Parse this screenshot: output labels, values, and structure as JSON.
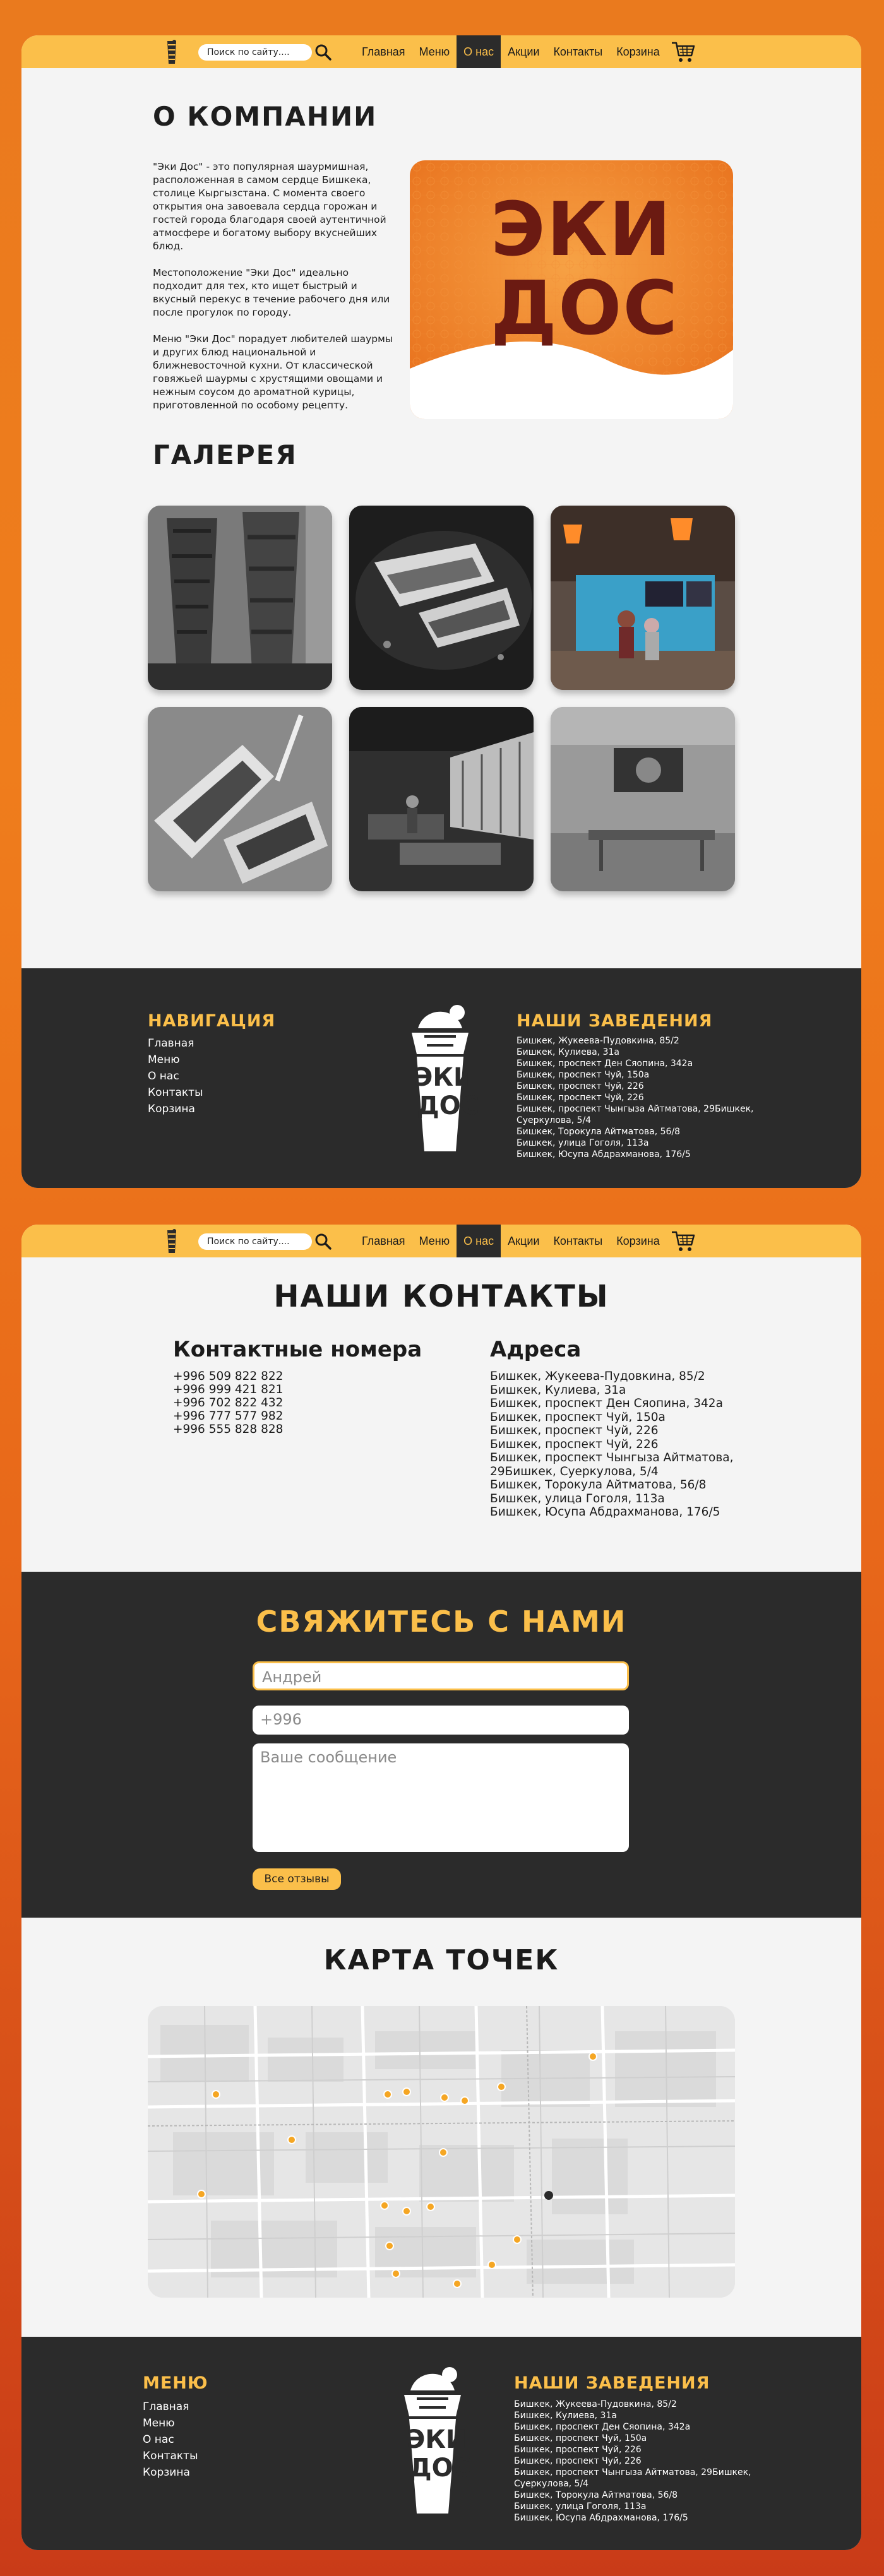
{
  "colors": {
    "accent": "#fbbf4a",
    "dark": "#2b2b2b",
    "page": "#f4f4f4",
    "brand_orange": "#ee7a20",
    "brand_red": "#6b1a12"
  },
  "header": {
    "search_placeholder": "Поиск по сайту....",
    "nav": [
      "Главная",
      "Меню",
      "О нас",
      "Акции",
      "Контакты",
      "Корзина"
    ],
    "active": "О нас"
  },
  "about": {
    "title": "О КОМПАНИИ",
    "paragraphs": [
      "\"Эки Дос\" - это популярная шаурмишная, расположенная в самом сердце Бишкека, столице Кыргызстана. С момента своего открытия она завоевала сердца горожан и гостей города благодаря своей аутентичной атмосфере и богатому выбору вкуснейших блюд.",
      "Местоположение \"Эки Дос\" идеально подходит для тех, кто ищет быстрый и вкусный перекус в течение рабочего дня или после прогулок по городу.",
      "Меню \"Эки Дос\" порадует любителей шаурмы и других блюд национальной и ближневосточной кухни. От классической говяжьей шаурмы с хрустящими овощами и нежным соусом до ароматной курицы, приготовленной по особому рецепту."
    ],
    "brand_line1": "ЭКИ",
    "brand_line2": "ДОС"
  },
  "gallery": {
    "title": "ГАЛЕРЕЯ"
  },
  "footer1": {
    "nav_title": "НАВИГАЦИЯ",
    "links": [
      "Главная",
      "Меню",
      "О нас",
      "Контакты",
      "Корзина"
    ],
    "logo_line1": "ЭКИ",
    "logo_line2": "ДОС",
    "places_title": "НАШИ ЗАВЕДЕНИЯ",
    "addresses": "Бишкек, Жукеева-Пудовкина, 85/2\nБишкек, Кулиева, 31а\nБишкек, проспект Ден Сяопина, 342а\nБишкек, проспект Чуй, 150а\nБишкек, проспект Чуй, 226\nБишкек, проспект Чуй, 226\nБишкек, проспект Чынгыза Айтматова, 29Бишкек, Суеркулова, 5/4\nБишкек, Торокула Айтматова, 56/8\nБишкек, улица Гоголя, 113а\nБишкек, Юсупа Абдрахманова, 176/5"
  },
  "contacts": {
    "title": "НАШИ КОНТАКТЫ",
    "phones_title": "Контактные номера",
    "phones": "+996 509 822 822\n+996 999 421 821\n+996 702 822 432\n+996 777 577 982\n+996 555 828 828",
    "addresses_title": "Адреса",
    "addresses": "Бишкек, Жукеева-Пудовкина, 85/2\nБишкек, Кулиева, 31а\nБишкек, проспект Ден Сяопина, 342а\nБишкек, проспект Чуй, 150а\nБишкек, проспект Чуй, 226\nБишкек, проспект Чуй, 226\nБишкек, проспект Чынгыза Айтматова, 29Бишкек, Суеркулова, 5/4\nБишкек, Торокула Айтматова, 56/8\nБишкек, улица Гоголя, 113а\nБишкек, Юсупа Абдрахманова, 176/5"
  },
  "form": {
    "title": "СВЯЖИТЕСЬ С НАМИ",
    "name_placeholder": "Андрей",
    "phone_placeholder": "+996",
    "message_placeholder": "Ваше сообщение",
    "reviews_button": "Все отзывы"
  },
  "map": {
    "title": "КАРТА ТОЧЕК"
  },
  "footer2": {
    "nav_title": "МЕНЮ",
    "links": [
      "Главная",
      "Меню",
      "О нас",
      "Контакты",
      "Корзина"
    ],
    "logo_line1": "ЭКИ",
    "logo_line2": "ДОС",
    "places_title": "НАШИ ЗАВЕДЕНИЯ",
    "addresses": "Бишкек, Жукеева-Пудовкина, 85/2\nБишкек, Кулиева, 31а\nБишкек, проспект Ден Сяопина, 342а\nБишкек, проспект Чуй, 150а\nБишкек, проспект Чуй, 226\nБишкек, проспект Чуй, 226\nБишкек, проспект Чынгыза Айтматова, 29Бишкек, Суеркулова, 5/4\nБишкек, Торокула Айтматова, 56/8\nБишкек, улица Гоголя, 113а\nБишкек, Юсупа Абдрахманова, 176/5"
  }
}
